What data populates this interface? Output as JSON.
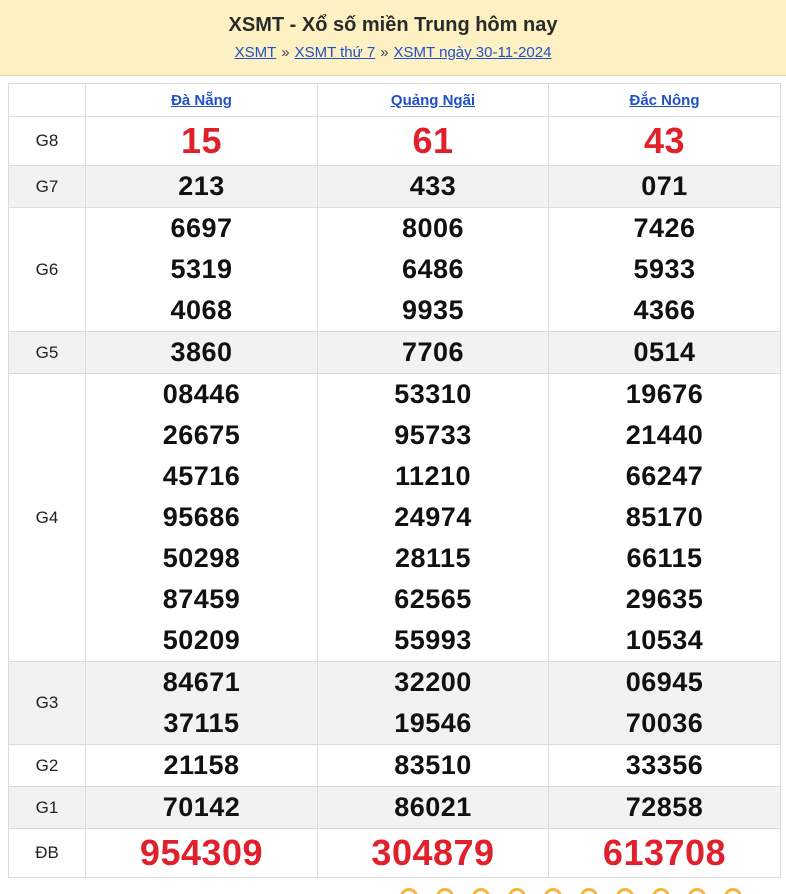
{
  "header": {
    "title": "XSMT - Xổ số miền Trung hôm nay",
    "breadcrumb": [
      "XSMT",
      "XSMT thứ 7",
      "XSMT ngày 30-11-2024"
    ],
    "separator": "»"
  },
  "table": {
    "provinces": [
      "Đà Nẵng",
      "Quảng Ngãi",
      "Đắc Nông"
    ],
    "rows": [
      {
        "label": "G8",
        "alt": false,
        "red": true,
        "values": [
          [
            "15"
          ],
          [
            "61"
          ],
          [
            "43"
          ]
        ]
      },
      {
        "label": "G7",
        "alt": true,
        "red": false,
        "values": [
          [
            "213"
          ],
          [
            "433"
          ],
          [
            "071"
          ]
        ]
      },
      {
        "label": "G6",
        "alt": false,
        "red": false,
        "values": [
          [
            "6697",
            "5319",
            "4068"
          ],
          [
            "8006",
            "6486",
            "9935"
          ],
          [
            "7426",
            "5933",
            "4366"
          ]
        ]
      },
      {
        "label": "G5",
        "alt": true,
        "red": false,
        "values": [
          [
            "3860"
          ],
          [
            "7706"
          ],
          [
            "0514"
          ]
        ]
      },
      {
        "label": "G4",
        "alt": false,
        "red": false,
        "values": [
          [
            "08446",
            "26675",
            "45716",
            "95686",
            "50298",
            "87459",
            "50209"
          ],
          [
            "53310",
            "95733",
            "11210",
            "24974",
            "28115",
            "62565",
            "55993"
          ],
          [
            "19676",
            "21440",
            "66247",
            "85170",
            "66115",
            "29635",
            "10534"
          ]
        ]
      },
      {
        "label": "G3",
        "alt": true,
        "red": false,
        "values": [
          [
            "84671",
            "37115"
          ],
          [
            "32200",
            "19546"
          ],
          [
            "06945",
            "70036"
          ]
        ]
      },
      {
        "label": "G2",
        "alt": false,
        "red": false,
        "values": [
          [
            "21158"
          ],
          [
            "83510"
          ],
          [
            "33356"
          ]
        ]
      },
      {
        "label": "G1",
        "alt": true,
        "red": false,
        "values": [
          [
            "70142"
          ],
          [
            "86021"
          ],
          [
            "72858"
          ]
        ]
      },
      {
        "label": "ĐB",
        "alt": false,
        "red": true,
        "values": [
          [
            "954309"
          ],
          [
            "304879"
          ],
          [
            "613708"
          ]
        ]
      }
    ]
  },
  "colors": {
    "header_bg": "#fdf1c4",
    "link": "#2050c8",
    "prize_red": "#e0202a",
    "alt_row": "#f2f2f2"
  }
}
